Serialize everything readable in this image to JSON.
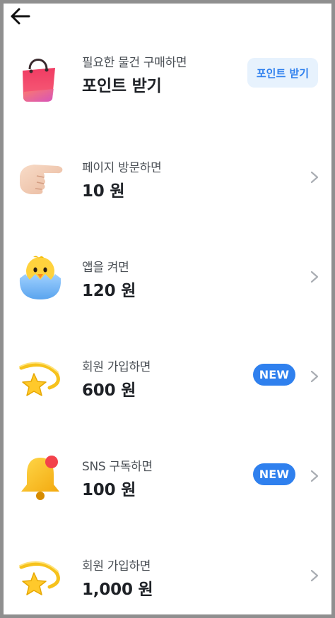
{
  "header": {
    "back_icon": "arrow-left-icon"
  },
  "items": [
    {
      "icon": "shopping-bag-icon",
      "subtitle": "필요한 물건 구매하면",
      "amount": "포인트 받기",
      "action_label": "포인트 받기"
    },
    {
      "icon": "pointing-hand-icon",
      "subtitle": "페이지 방문하면",
      "amount": "10 원"
    },
    {
      "icon": "hatching-chick-icon",
      "subtitle": "앱을 켜면",
      "amount": "120 원"
    },
    {
      "icon": "shooting-star-icon",
      "subtitle": "회원 가입하면",
      "amount": "600 원",
      "badge": "NEW"
    },
    {
      "icon": "bell-icon",
      "subtitle": "SNS 구독하면",
      "amount": "100 원",
      "badge": "NEW"
    },
    {
      "icon": "shooting-star-icon",
      "subtitle": "회원 가입하면",
      "amount": "1,000 원"
    }
  ],
  "colors": {
    "accent": "#2f80ee",
    "accent_light_bg": "#e7f2fd",
    "chevron": "#a9adb3"
  }
}
